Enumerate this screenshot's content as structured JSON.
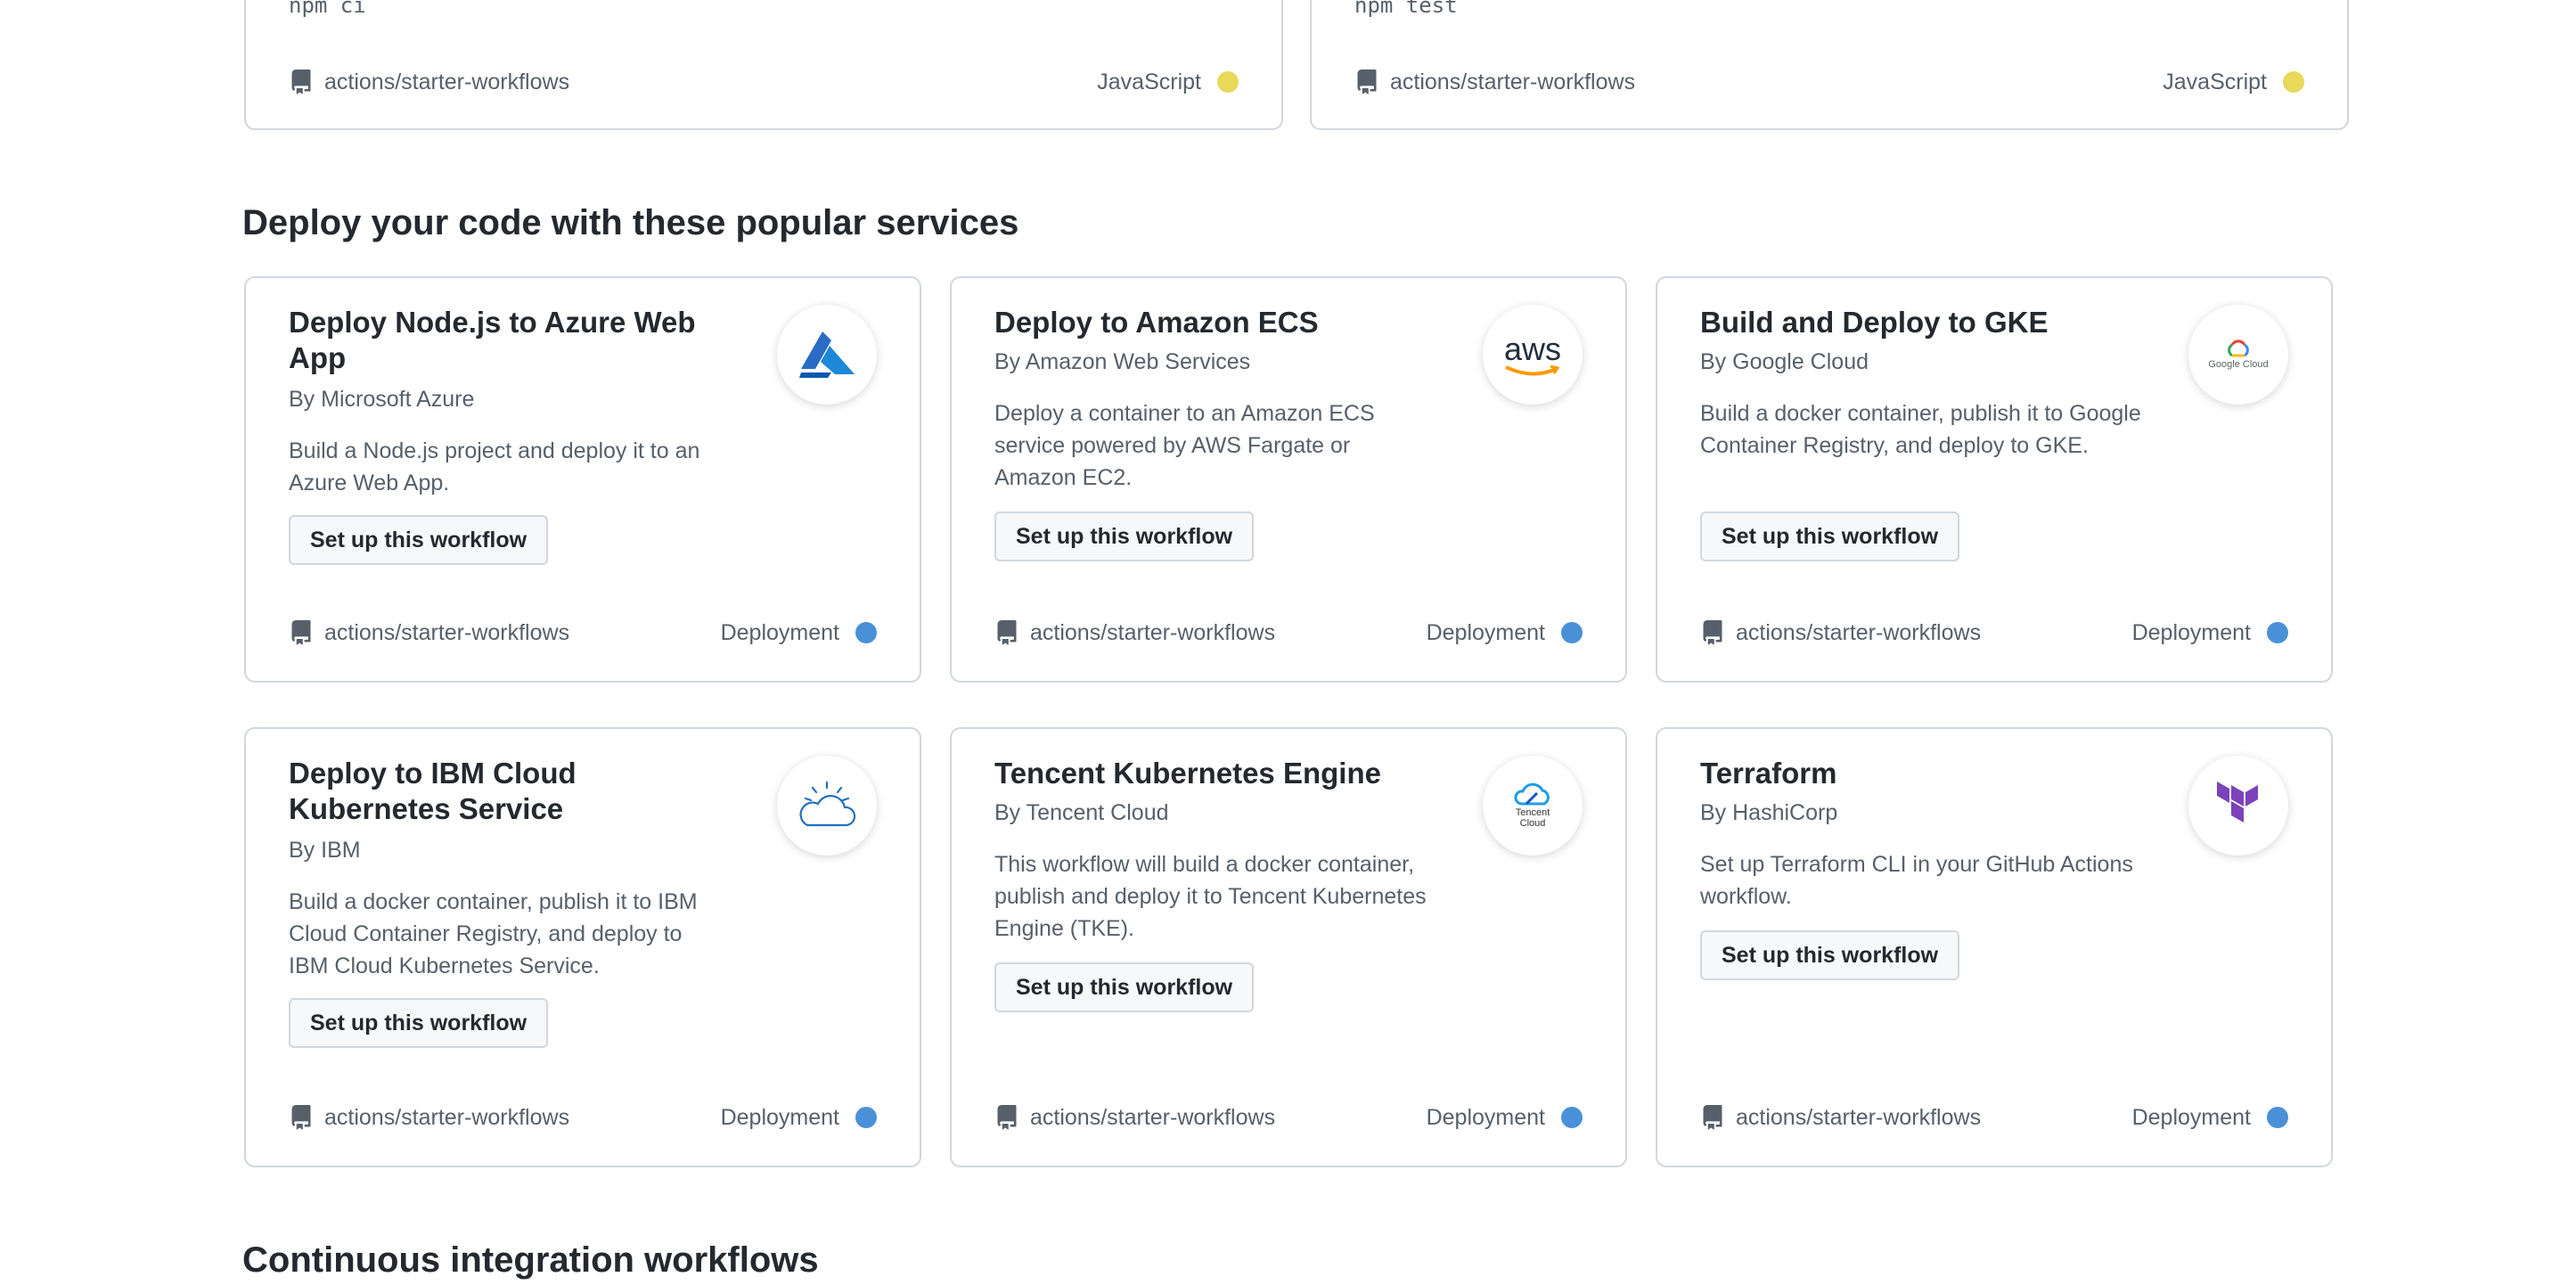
{
  "top_cards": [
    {
      "code": "npm ci",
      "repo": "actions/starter-workflows",
      "language": "JavaScript",
      "language_color": "#f1e05a"
    },
    {
      "code": "npm test",
      "repo": "actions/starter-workflows",
      "language": "JavaScript",
      "language_color": "#f1e05a"
    }
  ],
  "deploy_section": {
    "title": "Deploy your code with these popular services",
    "button_label": "Set up this workflow",
    "cards": [
      {
        "title": "Deploy Node.js to Azure Web App",
        "by": "By Microsoft Azure",
        "description": "Build a Node.js project and deploy it to an Azure Web App.",
        "repo": "actions/starter-workflows",
        "category": "Deployment",
        "logo": "azure-logo"
      },
      {
        "title": "Deploy to Amazon ECS",
        "by": "By Amazon Web Services",
        "description": "Deploy a container to an Amazon ECS service powered by AWS Fargate or Amazon EC2.",
        "repo": "actions/starter-workflows",
        "category": "Deployment",
        "logo": "aws-logo",
        "logo_text": "aws"
      },
      {
        "title": "Build and Deploy to GKE",
        "by": "By Google Cloud",
        "description": "Build a docker container, publish it to Google Container Registry, and deploy to GKE.",
        "repo": "actions/starter-workflows",
        "category": "Deployment",
        "logo": "google-cloud-logo",
        "logo_text": "Google Cloud"
      },
      {
        "title": "Deploy to IBM Cloud Kubernetes Service",
        "by": "By IBM",
        "description": "Build a docker container, publish it to IBM Cloud Container Registry, and deploy to IBM Cloud Kubernetes Service.",
        "repo": "actions/starter-workflows",
        "category": "Deployment",
        "logo": "ibm-cloud-logo"
      },
      {
        "title": "Tencent Kubernetes Engine",
        "by": "By Tencent Cloud",
        "description": "This workflow will build a docker container, publish and deploy it to Tencent Kubernetes Engine (TKE).",
        "repo": "actions/starter-workflows",
        "category": "Deployment",
        "logo": "tencent-cloud-logo",
        "logo_text": "Tencent Cloud"
      },
      {
        "title": "Terraform",
        "by": "By HashiCorp",
        "description": "Set up Terraform CLI in your GitHub Actions workflow.",
        "repo": "actions/starter-workflows",
        "category": "Deployment",
        "logo": "terraform-logo"
      }
    ],
    "category_color": "#4a90d9"
  },
  "ci_section": {
    "title": "Continuous integration workflows"
  }
}
